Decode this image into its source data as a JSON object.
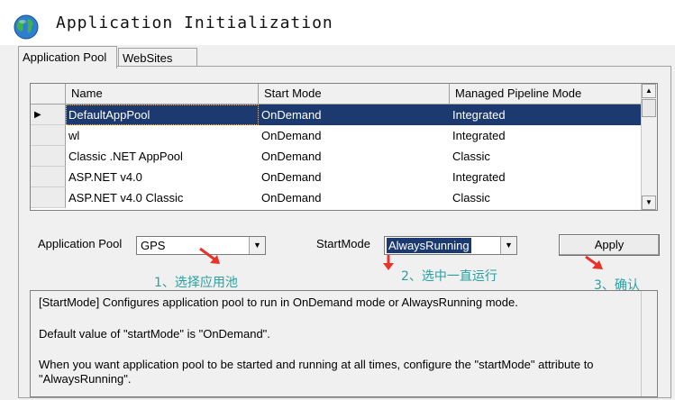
{
  "window": {
    "title": "Application Initialization",
    "icon": "globe-icon"
  },
  "tabs": [
    {
      "label": "Application Pool",
      "active": true
    },
    {
      "label": "WebSites",
      "active": false
    }
  ],
  "grid": {
    "columns": [
      "Name",
      "Start Mode",
      "Managed Pipeline Mode"
    ],
    "rows": [
      {
        "name": "DefaultAppPool",
        "start_mode": "OnDemand",
        "pipeline": "Integrated",
        "selected": true
      },
      {
        "name": "wl",
        "start_mode": "OnDemand",
        "pipeline": "Integrated",
        "selected": false
      },
      {
        "name": "Classic .NET AppPool",
        "start_mode": "OnDemand",
        "pipeline": "Classic",
        "selected": false
      },
      {
        "name": "ASP.NET v4.0",
        "start_mode": "OnDemand",
        "pipeline": "Integrated",
        "selected": false
      },
      {
        "name": "ASP.NET v4.0 Classic",
        "start_mode": "OnDemand",
        "pipeline": "Classic",
        "selected": false
      }
    ],
    "row_indicator": "▶"
  },
  "form": {
    "pool_label": "Application Pool",
    "pool_value": "GPS",
    "startmode_label": "StartMode",
    "startmode_value": "AlwaysRunning",
    "apply_label": "Apply"
  },
  "annotations": {
    "step1": "1、选择应用池",
    "step2": "2、选中一直运行",
    "step3": "3、确认",
    "color": "#2aa0a0",
    "arrow_color": "#e8332a"
  },
  "description": {
    "line1": "[StartMode] Configures application pool to run in OnDemand mode or AlwaysRunning mode.",
    "line2": "Default value of \"startMode\" is \"OnDemand\".",
    "line3": "When you want application pool to be started and running at all times, configure the \"startMode\" attribute to \"AlwaysRunning\"."
  },
  "colors": {
    "selection": "#1c3a70",
    "panel": "#f0f0f0"
  }
}
